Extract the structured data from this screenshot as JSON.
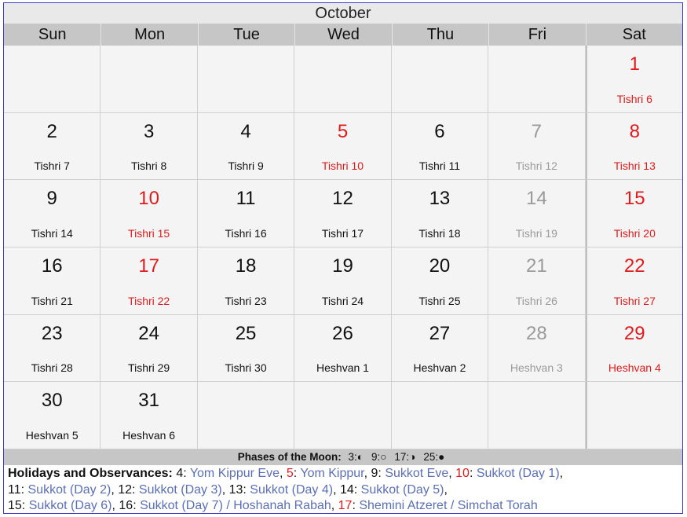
{
  "calendar": {
    "month": "October",
    "weekdays": [
      "Sun",
      "Mon",
      "Tue",
      "Wed",
      "Thu",
      "Fri",
      "Sat"
    ],
    "cells": [
      {
        "day": "",
        "heb": "",
        "style": ""
      },
      {
        "day": "",
        "heb": "",
        "style": ""
      },
      {
        "day": "",
        "heb": "",
        "style": ""
      },
      {
        "day": "",
        "heb": "",
        "style": ""
      },
      {
        "day": "",
        "heb": "",
        "style": ""
      },
      {
        "day": "",
        "heb": "",
        "style": ""
      },
      {
        "day": "1",
        "heb": "Tishri 6",
        "style": "red"
      },
      {
        "day": "2",
        "heb": "Tishri 7",
        "style": ""
      },
      {
        "day": "3",
        "heb": "Tishri 8",
        "style": ""
      },
      {
        "day": "4",
        "heb": "Tishri 9",
        "style": ""
      },
      {
        "day": "5",
        "heb": "Tishri 10",
        "style": "red"
      },
      {
        "day": "6",
        "heb": "Tishri 11",
        "style": ""
      },
      {
        "day": "7",
        "heb": "Tishri 12",
        "style": "gray"
      },
      {
        "day": "8",
        "heb": "Tishri 13",
        "style": "red"
      },
      {
        "day": "9",
        "heb": "Tishri 14",
        "style": ""
      },
      {
        "day": "10",
        "heb": "Tishri 15",
        "style": "red"
      },
      {
        "day": "11",
        "heb": "Tishri 16",
        "style": ""
      },
      {
        "day": "12",
        "heb": "Tishri 17",
        "style": ""
      },
      {
        "day": "13",
        "heb": "Tishri 18",
        "style": ""
      },
      {
        "day": "14",
        "heb": "Tishri 19",
        "style": "gray"
      },
      {
        "day": "15",
        "heb": "Tishri 20",
        "style": "red"
      },
      {
        "day": "16",
        "heb": "Tishri 21",
        "style": ""
      },
      {
        "day": "17",
        "heb": "Tishri 22",
        "style": "red"
      },
      {
        "day": "18",
        "heb": "Tishri 23",
        "style": ""
      },
      {
        "day": "19",
        "heb": "Tishri 24",
        "style": ""
      },
      {
        "day": "20",
        "heb": "Tishri 25",
        "style": ""
      },
      {
        "day": "21",
        "heb": "Tishri 26",
        "style": "gray"
      },
      {
        "day": "22",
        "heb": "Tishri 27",
        "style": "red"
      },
      {
        "day": "23",
        "heb": "Tishri 28",
        "style": ""
      },
      {
        "day": "24",
        "heb": "Tishri 29",
        "style": ""
      },
      {
        "day": "25",
        "heb": "Tishri 30",
        "style": ""
      },
      {
        "day": "26",
        "heb": "Heshvan 1",
        "style": ""
      },
      {
        "day": "27",
        "heb": "Heshvan 2",
        "style": ""
      },
      {
        "day": "28",
        "heb": "Heshvan 3",
        "style": "gray"
      },
      {
        "day": "29",
        "heb": "Heshvan 4",
        "style": "red"
      },
      {
        "day": "30",
        "heb": "Heshvan 5",
        "style": ""
      },
      {
        "day": "31",
        "heb": "Heshvan 6",
        "style": ""
      },
      {
        "day": "",
        "heb": "",
        "style": ""
      },
      {
        "day": "",
        "heb": "",
        "style": ""
      },
      {
        "day": "",
        "heb": "",
        "style": ""
      },
      {
        "day": "",
        "heb": "",
        "style": ""
      },
      {
        "day": "",
        "heb": "",
        "style": ""
      }
    ]
  },
  "moon": {
    "label": "Phases of the Moon:",
    "phases": [
      {
        "text": "3:",
        "icon": "first-quarter-moon-icon",
        "glyph": "◐"
      },
      {
        "text": "9:",
        "icon": "full-moon-icon",
        "glyph": "○"
      },
      {
        "text": "17:",
        "icon": "last-quarter-moon-icon",
        "glyph": "◑"
      },
      {
        "text": "25:",
        "icon": "new-moon-icon",
        "glyph": "●"
      }
    ]
  },
  "holidays": {
    "label": "Holidays and Observances:",
    "lines": [
      [
        {
          "date": "4",
          "name": "Yom Kippur Eve",
          "red": false,
          "sep": ", "
        },
        {
          "date": "5",
          "name": "Yom Kippur",
          "red": true,
          "sep": ", "
        },
        {
          "date": "9",
          "name": "Sukkot Eve",
          "red": false,
          "sep": ", "
        },
        {
          "date": "10",
          "name": "Sukkot (Day 1)",
          "red": true,
          "sep": ","
        }
      ],
      [
        {
          "date": "11",
          "name": "Sukkot (Day 2)",
          "red": false,
          "sep": ", "
        },
        {
          "date": "12",
          "name": "Sukkot (Day 3)",
          "red": false,
          "sep": ", "
        },
        {
          "date": "13",
          "name": "Sukkot (Day 4)",
          "red": false,
          "sep": ", "
        },
        {
          "date": "14",
          "name": "Sukkot (Day 5)",
          "red": false,
          "sep": ","
        }
      ],
      [
        {
          "date": "15",
          "name": "Sukkot (Day 6)",
          "red": false,
          "sep": ", "
        },
        {
          "date": "16",
          "name": "Sukkot (Day 7) / Hoshanah Rabah",
          "red": false,
          "sep": ", "
        },
        {
          "date": "17",
          "name": "Shemini Atzeret / Simchat Torah",
          "red": true,
          "sep": ""
        }
      ]
    ]
  },
  "colors": {
    "holiday_red": "#e01b1b",
    "holiday_link": "#5a6fb8",
    "past_gray": "#9a9a9a",
    "header_gray": "#c6c6c6",
    "frame_blue": "#3a3ac8"
  }
}
